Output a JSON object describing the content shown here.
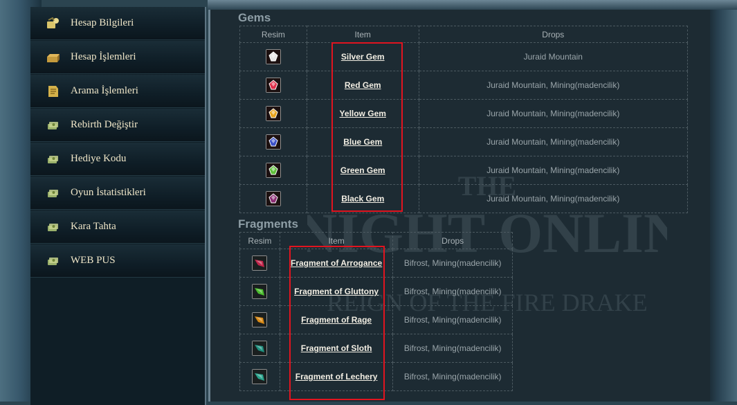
{
  "sidebar": {
    "items": [
      {
        "label": "Hesap Bilgileri",
        "icon": "account-info-icon",
        "color": "#d9c46a"
      },
      {
        "label": "Hesap İşlemleri",
        "icon": "chest-icon",
        "color": "#c49a3d"
      },
      {
        "label": "Arama İşlemleri",
        "icon": "document-icon",
        "color": "#d4b14a"
      },
      {
        "label": "Rebirth Değiştir",
        "icon": "money-icon",
        "color": "#9ab06b"
      },
      {
        "label": "Hediye Kodu",
        "icon": "money-icon",
        "color": "#9ab06b"
      },
      {
        "label": "Oyun İstatistikleri",
        "icon": "money-icon",
        "color": "#9ab06b"
      },
      {
        "label": "Kara Tahta",
        "icon": "money-icon",
        "color": "#9ab06b"
      },
      {
        "label": "WEB PUS",
        "icon": "money-icon",
        "color": "#9ab06b"
      }
    ]
  },
  "gems": {
    "title": "Gems",
    "headers": {
      "image": "Resim",
      "item": "Item",
      "drops": "Drops"
    },
    "rows": [
      {
        "item": "Silver Gem",
        "drops": "Juraid Mountain",
        "color": "#e5e5e5"
      },
      {
        "item": "Red Gem",
        "drops": "Juraid Mountain, Mining(madencilik)",
        "color": "#e0304a"
      },
      {
        "item": "Yellow Gem",
        "drops": "Juraid Mountain, Mining(madencilik)",
        "color": "#e7a21c"
      },
      {
        "item": "Blue Gem",
        "drops": "Juraid Mountain, Mining(madencilik)",
        "color": "#3b50c8"
      },
      {
        "item": "Green Gem",
        "drops": "Juraid Mountain, Mining(madencilik)",
        "color": "#5fbf3a"
      },
      {
        "item": "Black Gem",
        "drops": "Juraid Mountain, Mining(madencilik)",
        "color": "#8a2c72"
      }
    ]
  },
  "fragments": {
    "title": "Fragments",
    "headers": {
      "image": "Resim",
      "item": "Item",
      "drops": "Drops"
    },
    "rows": [
      {
        "item": "Fragment of Arrogance",
        "drops": "Bifrost, Mining(madencilik)",
        "color": "#c2254a"
      },
      {
        "item": "Fragment of Gluttony",
        "drops": "Bifrost, Mining(madencilik)",
        "color": "#4bbd2e"
      },
      {
        "item": "Fragment of Rage",
        "drops": "Bifrost, Mining(madencilik)",
        "color": "#d98a16"
      },
      {
        "item": "Fragment of Sloth",
        "drops": "Bifrost, Mining(madencilik)",
        "color": "#1f8f7e"
      },
      {
        "item": "Fragment of Lechery",
        "drops": "Bifrost, Mining(madencilik)",
        "color": "#2aa38c"
      }
    ]
  },
  "watermark": {
    "line1": "THE",
    "line2": "KNIGHT ONLINE",
    "line3": "REIGN OF THE FIRE DRAKE"
  },
  "colors": {
    "highlight": "#e2141f",
    "link": "#f3efe4",
    "sidebar_text": "#efe6c8"
  }
}
